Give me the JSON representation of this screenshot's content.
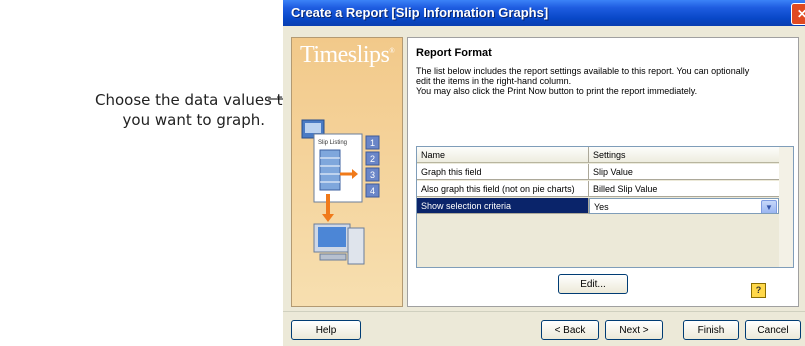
{
  "callout": {
    "line1": "Choose the data values that",
    "line2": "you want to graph."
  },
  "window": {
    "title": "Create a Report [Slip Information Graphs]",
    "close_glyph": "✕"
  },
  "sidebar": {
    "logo": "Timeslips",
    "logo_mark": "®",
    "doc_label": "Slip Listing",
    "steps": [
      "1",
      "2",
      "3",
      "4"
    ]
  },
  "content": {
    "heading": "Report Format",
    "description": [
      "The list below includes the report settings available to this report. You can optionally",
      "edit the items in the right-hand column.",
      "You may also click the Print Now button to print the report immediately."
    ]
  },
  "grid": {
    "columns": [
      "Name",
      "Settings"
    ],
    "rows": [
      {
        "name": "Graph this field",
        "setting": "Slip Value"
      },
      {
        "name": "Also graph this field (not on pie charts)",
        "setting": "Billed Slip Value"
      },
      {
        "name": "Show selection criteria",
        "setting": "Yes"
      }
    ],
    "dropdown_glyph": "▼"
  },
  "buttons": {
    "edit": "Edit...",
    "help": "Help",
    "back": "< Back",
    "next": "Next >",
    "finish": "Finish",
    "cancel": "Cancel"
  },
  "icons": {
    "help_icon_glyph": "?"
  },
  "colors": {
    "title_bar": "#0848c8",
    "selection": "#0a246a",
    "sidebar": "#f2c98a",
    "dialog_bg": "#ece9d8"
  }
}
